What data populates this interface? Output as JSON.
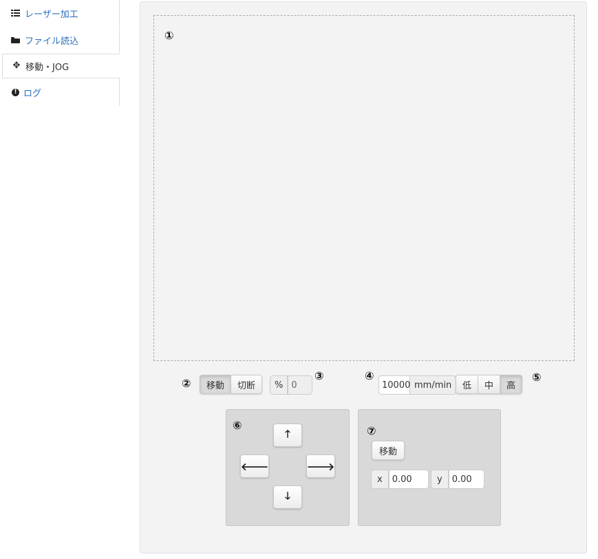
{
  "sidebar": {
    "items": [
      {
        "label": "レーザー加工",
        "icon": "list-icon"
      },
      {
        "label": "ファイル読込",
        "icon": "folder-icon"
      },
      {
        "label": "移動・JOG",
        "icon": "move-icon"
      },
      {
        "label": "ログ",
        "icon": "alert-icon"
      }
    ]
  },
  "markers": {
    "m1": "①",
    "m2": "②",
    "m3": "③",
    "m4": "④",
    "m5": "⑤",
    "m6": "⑥",
    "m7": "⑦"
  },
  "mode": {
    "options": [
      "移動",
      "切断"
    ],
    "selected": "移動"
  },
  "power": {
    "unit": "%",
    "value": "0"
  },
  "speed": {
    "value": "10000",
    "unit": "mm/min"
  },
  "level": {
    "options": [
      "低",
      "中",
      "高"
    ],
    "selected": "高"
  },
  "jog": {
    "up": "🡑",
    "left": "🡐",
    "right": "🡒",
    "down": "🡓"
  },
  "goto": {
    "button": "移動",
    "x_label": "x",
    "x_value": "0.00",
    "y_label": "y",
    "y_value": "0.00"
  },
  "colors": {
    "link": "#2a6ebb",
    "panel": "#f3f3f3",
    "box": "#d9d9d9"
  }
}
